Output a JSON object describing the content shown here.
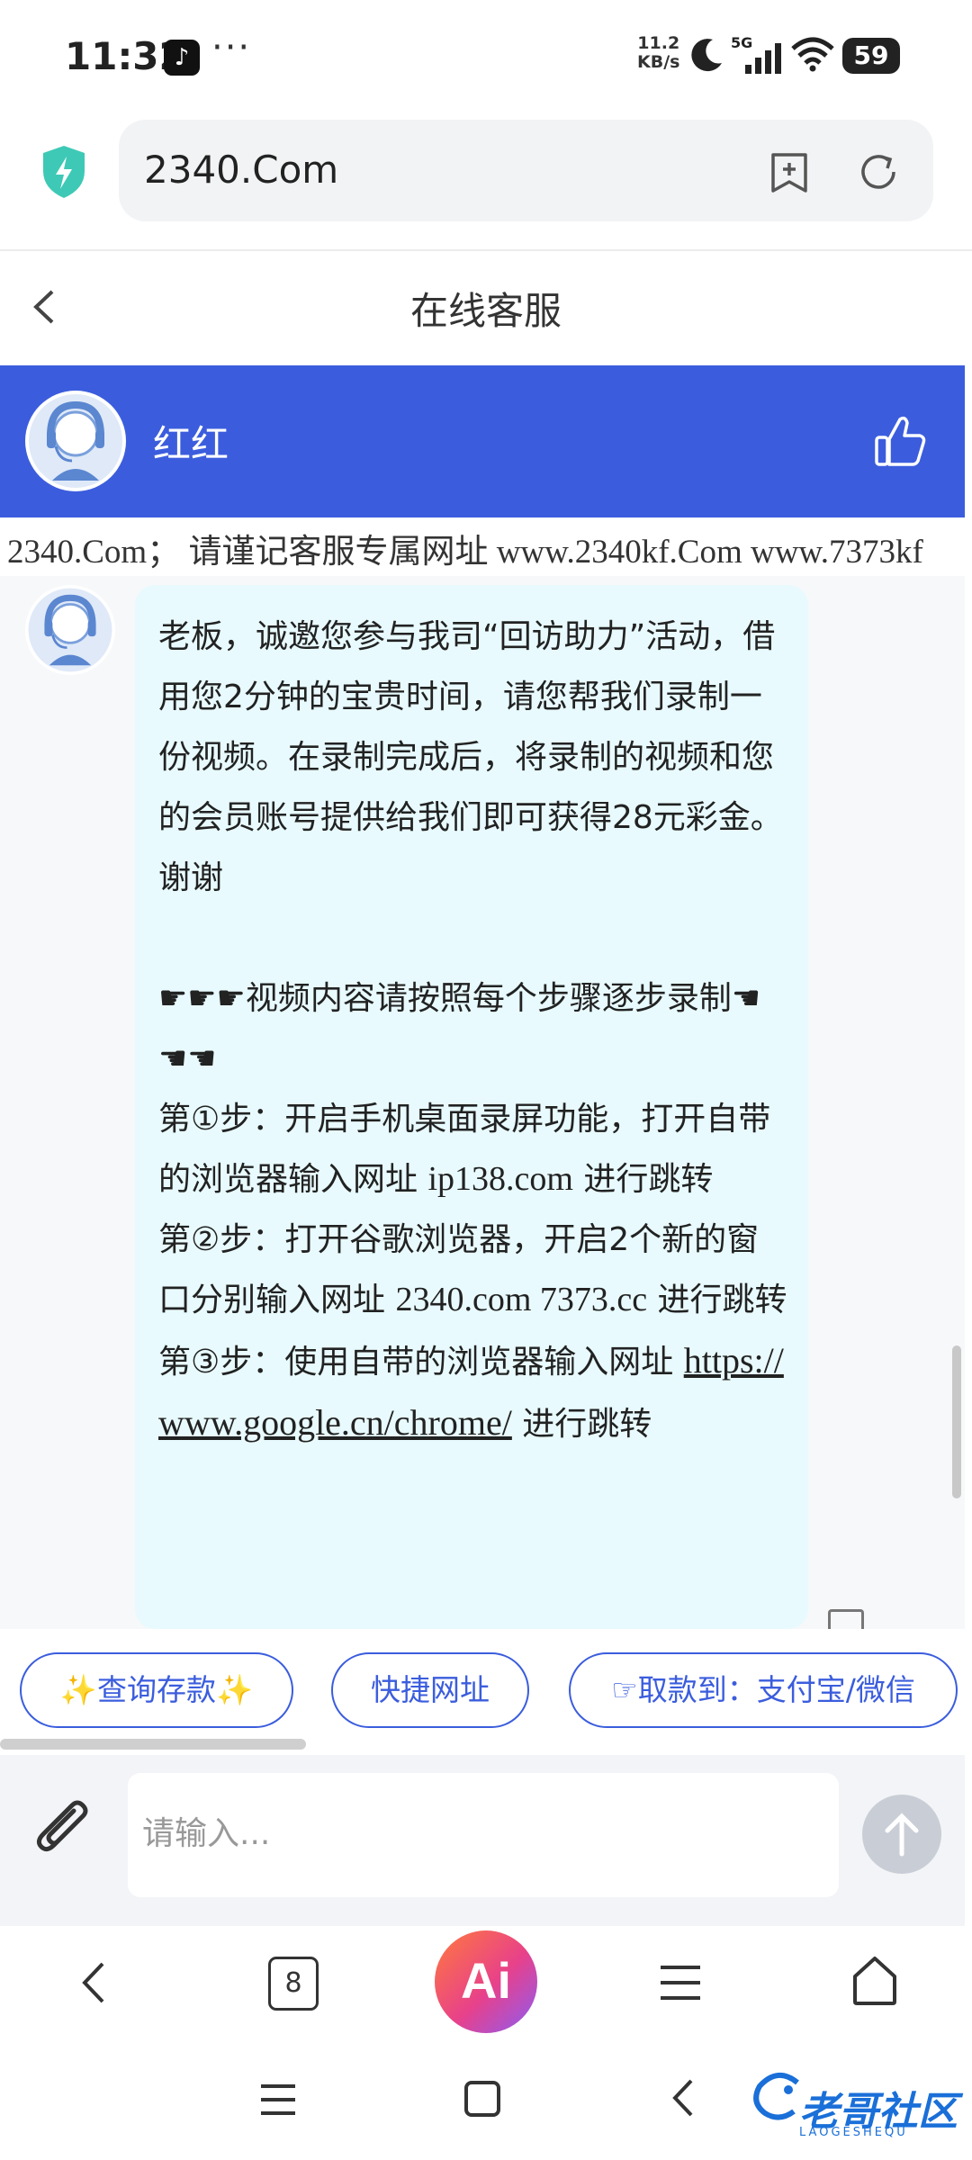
{
  "status_bar": {
    "time": "11:32",
    "more": "···",
    "net_speed_value": "11.2",
    "net_speed_unit": "KB/s",
    "network": "5G",
    "battery": "59"
  },
  "browser": {
    "url": "2340.Com",
    "tab_count": "8",
    "ai_label": "Ai"
  },
  "page": {
    "title": "在线客服",
    "agent_name": "红红",
    "marquee": "2340.Com； 请谨记客服专属网址 www.2340kf.Com www.7373kf"
  },
  "message": {
    "intro": "老板，诚邀您参与我司“回访助力”活动，借用您2分钟的宝贵时间，请您帮我们录制一份视频。在录制完成后，将录制的视频和您的会员账号提供给我们即可获得28元彩金。谢谢",
    "steps_header_prefix": "☛☛☛",
    "steps_header": "视频内容请按照每个步骤逐步录制",
    "steps_header_suffix": "☚☚☚",
    "step1_a": "第①步：开启手机桌面录屏功能，打开自带的浏览器输入网址 ",
    "step1_url": "ip138.com",
    "step1_b": " 进行跳转",
    "step2_a": "第②步：打开谷歌浏览器，开启2个新的窗口分别输入网址 ",
    "step2_url": "2340.com 7373.cc",
    "step2_b": " 进行跳转",
    "step3_a": "第③步：使用自带的浏览器输入网址 ",
    "step3_link": "https://www.google.cn/chrome/",
    "step3_b": " 进行跳转"
  },
  "quick_buttons": [
    {
      "label": "✨查询存款✨"
    },
    {
      "label": "快捷网址"
    },
    {
      "label": "☞取款到：支付宝/微信"
    }
  ],
  "input": {
    "placeholder": "请输入..."
  },
  "watermark": {
    "text": "老哥社区",
    "sub": "LAOGESHEQU"
  },
  "colors": {
    "accent": "#3b5ddd",
    "bubble": "#e8fafd"
  }
}
